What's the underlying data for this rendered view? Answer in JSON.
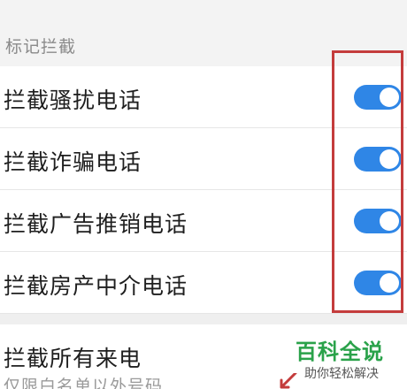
{
  "section": {
    "title": "标记拦截"
  },
  "rows": [
    {
      "label": "拦截骚扰电话",
      "enabled": true
    },
    {
      "label": "拦截诈骗电话",
      "enabled": true
    },
    {
      "label": "拦截广告推销电话",
      "enabled": true
    },
    {
      "label": "拦截房产中介电话",
      "enabled": true
    }
  ],
  "all_calls": {
    "label": "拦截所有来电",
    "subtitle": "仅限白名单以外号码"
  },
  "watermark": {
    "title": "百科全说",
    "subtitle": "助你轻松解决"
  },
  "colors": {
    "toggle_on": "#2f86e6",
    "annotation": "#c43c3c",
    "watermark_green": "#2aa24a"
  }
}
